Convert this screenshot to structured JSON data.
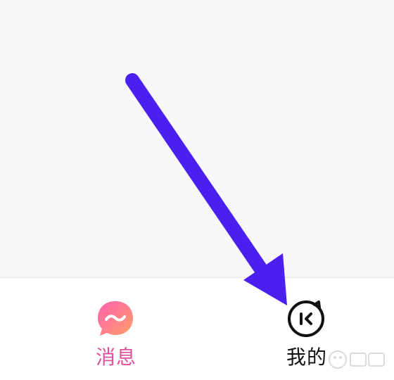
{
  "tab_bar": {
    "items": [
      {
        "label": "消息",
        "icon": "message-bubble-icon",
        "color": "#e0509a",
        "active": true
      },
      {
        "label": "我的",
        "icon": "profile-face-icon",
        "color": "#111111",
        "active": false
      }
    ]
  },
  "colors": {
    "arrow": "#4a1ff0",
    "content_background": "#f8f8fa",
    "message_gradient_start": "#ff66b3",
    "message_gradient_end": "#ff9966"
  },
  "annotation": {
    "icon": "pointer-arrow-icon"
  }
}
